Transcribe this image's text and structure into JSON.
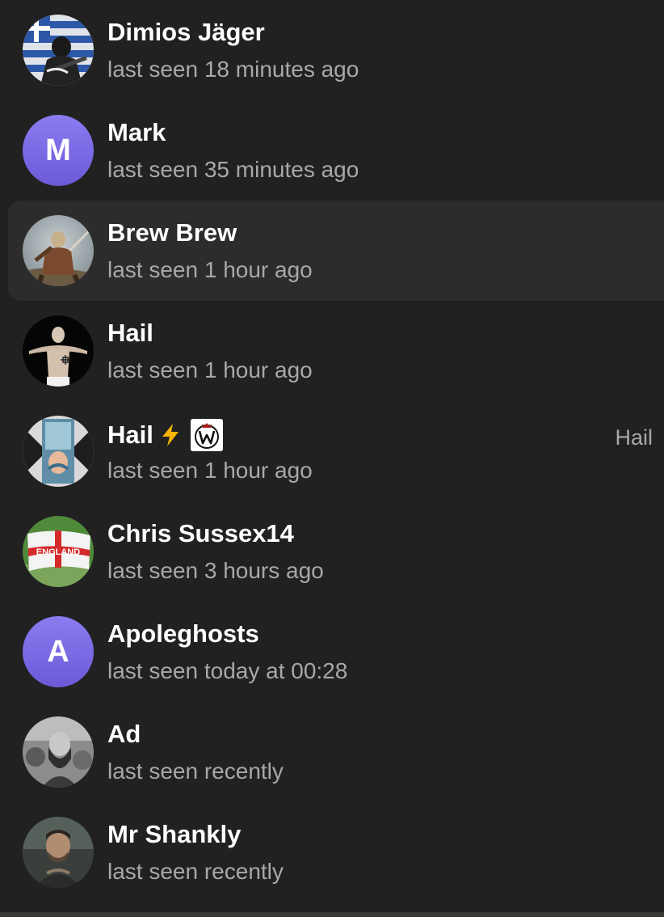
{
  "contacts": [
    {
      "name": "Dimios Jäger",
      "status": "last seen 18 minutes ago",
      "avatar": "photo-avatar-flag-soldier"
    },
    {
      "name": "Mark",
      "status": "last seen 35 minutes ago",
      "avatar_letter": "M"
    },
    {
      "name": "Brew Brew",
      "status": "last seen 1 hour ago",
      "avatar": "photo-avatar-warrior-painting",
      "selected": true
    },
    {
      "name": "Hail",
      "status": "last seen 1 hour ago",
      "avatar": "photo-avatar-man"
    },
    {
      "name": "Hail",
      "status": "last seen 1 hour ago",
      "avatar": "photo-avatar-art",
      "right_label": "Hail",
      "name_icons": [
        "lightning-bolt-icon",
        "w-badge-icon"
      ]
    },
    {
      "name": "Chris Sussex14",
      "status": "last seen 3 hours ago",
      "avatar": "photo-avatar-england-flag",
      "flag_text": "ENGLAND"
    },
    {
      "name": "Apoleghosts",
      "status": "last seen today at 00:28",
      "avatar_letter": "A"
    },
    {
      "name": "Ad",
      "status": "last seen recently",
      "avatar": "photo-avatar-bearded-man"
    },
    {
      "name": "Mr Shankly",
      "status": "last seen recently",
      "avatar": "photo-avatar-man-portrait"
    }
  ],
  "colors": {
    "background": "#212121",
    "selected_row": "#2c2c2c",
    "letter_avatar": "#7b6be6",
    "status_text": "#a8a8a8"
  }
}
